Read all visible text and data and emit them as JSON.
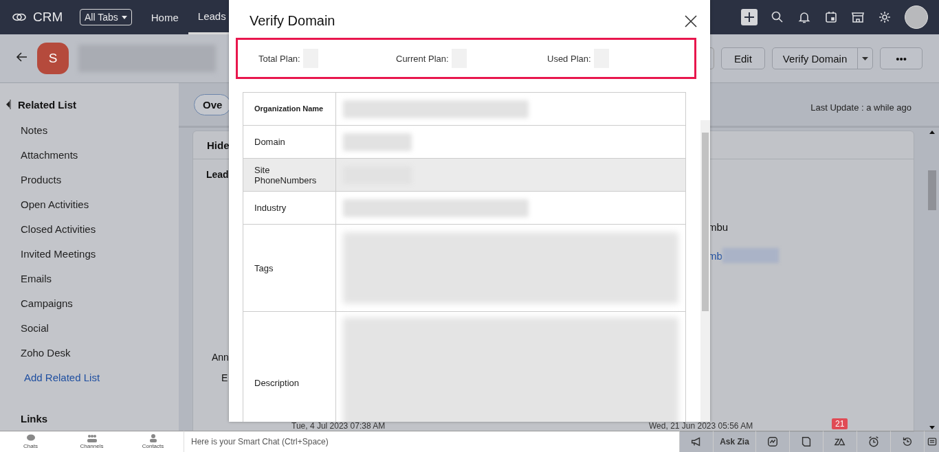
{
  "topbar": {
    "logo": "CRM",
    "all_tabs": "All Tabs",
    "tabs": [
      {
        "label": "Home",
        "selected": false
      },
      {
        "label": "Leads",
        "selected": true
      }
    ]
  },
  "record": {
    "avatar_letter": "S",
    "buttons": [
      {
        "label": "Edit",
        "kind": "plain"
      },
      {
        "label": "Verify Domain",
        "kind": "split"
      },
      {
        "label": "•••",
        "kind": "more"
      }
    ]
  },
  "sidebar": {
    "heading": "Related List",
    "items": [
      "Notes",
      "Attachments",
      "Products",
      "Open Activities",
      "Closed Activities",
      "Invited Meetings",
      "Emails",
      "Campaigns",
      "Social",
      "Zoho Desk"
    ],
    "add_link": "Add Related List",
    "links_heading": "Links"
  },
  "main": {
    "tab": "Ove",
    "last_update": "Last Update : a while ago",
    "section_toggle": "Hide",
    "section_title": "Lead",
    "field_labels": [
      "Ann",
      "E"
    ],
    "field_values": [
      {
        "text": "mbu",
        "kind": "plain"
      },
      {
        "text": "mb",
        "kind": "link"
      }
    ],
    "dates": [
      "Tue, 4 Jul 2023 07:38 AM",
      "Wed, 21 Jun 2023 05:56 AM"
    ]
  },
  "dialog": {
    "title": "Verify Domain",
    "plans": [
      "Total Plan:",
      "Current Plan:",
      "Used Plan:"
    ],
    "rows": [
      {
        "label": "Organization Name",
        "shaded": false,
        "kind": "single"
      },
      {
        "label": "Domain",
        "shaded": false,
        "kind": "short"
      },
      {
        "label": "Site PhoneNumbers",
        "shaded": true,
        "kind": "short"
      },
      {
        "label": "Industry",
        "shaded": false,
        "kind": "single"
      },
      {
        "label": "Tags",
        "shaded": false,
        "kind": "multi"
      },
      {
        "label": "Description",
        "shaded": false,
        "kind": "long"
      }
    ]
  },
  "bottom_bar": {
    "apps": [
      "Chats",
      "Channels",
      "Contacts"
    ],
    "chat": {
      "placeholder": "Here is your Smart Chat (Ctrl+Space)"
    },
    "ask_zia": "Ask Zia",
    "badge": "21"
  }
}
